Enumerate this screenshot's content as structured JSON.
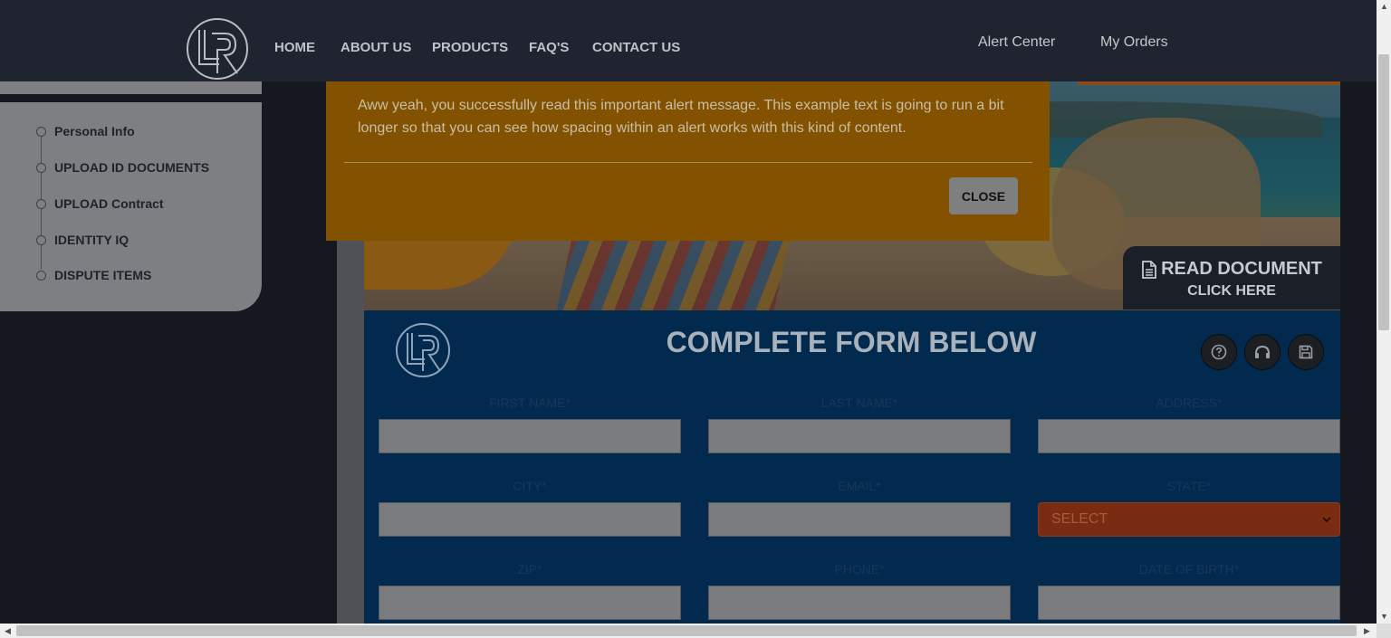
{
  "navbar": {
    "links": [
      "HOME",
      "ABOUT US",
      "PRODUCTS",
      "FAQ'S",
      "CONTACT US"
    ],
    "right_links": [
      "Alert Center",
      "My Orders"
    ]
  },
  "sidebar": {
    "steps": [
      "Personal Info",
      "UPLOAD ID DOCUMENTS",
      "UPLOAD Contract",
      "IDENTITY IQ",
      "DISPUTE ITEMS"
    ]
  },
  "read_document": {
    "title": "READ DOCUMENT",
    "subtitle": "CLICK HERE"
  },
  "form": {
    "title": "COMPLETE FORM BELOW",
    "fields": {
      "first_name": {
        "label": "FIRST NAME*",
        "value": ""
      },
      "last_name": {
        "label": "LAST NAME*",
        "value": ""
      },
      "address": {
        "label": "ADDRESS*",
        "value": ""
      },
      "city": {
        "label": "CITY*",
        "value": ""
      },
      "email": {
        "label": "EMAIL*",
        "value": ""
      },
      "state": {
        "label": "STATE*",
        "value": "SELECT"
      },
      "zip": {
        "label": "ZIP*",
        "value": ""
      },
      "phone": {
        "label": "PHONE*",
        "value": ""
      },
      "date_of_birth": {
        "label": "DATE OF BIRTH*",
        "value": ""
      }
    },
    "action_icons": [
      "help-icon",
      "reset-icon",
      "save-icon"
    ]
  },
  "alert": {
    "message": "Aww yeah, you successfully read this important alert message. This example text is going to run a bit longer so that you can see how spacing within an alert works with this kind of content.",
    "close_label": "CLOSE"
  },
  "colors": {
    "navbar_bg": "#1f2430",
    "alert_bg": "#825200",
    "form_bg": "#012a4e",
    "state_select_bg": "#7a2c12"
  }
}
